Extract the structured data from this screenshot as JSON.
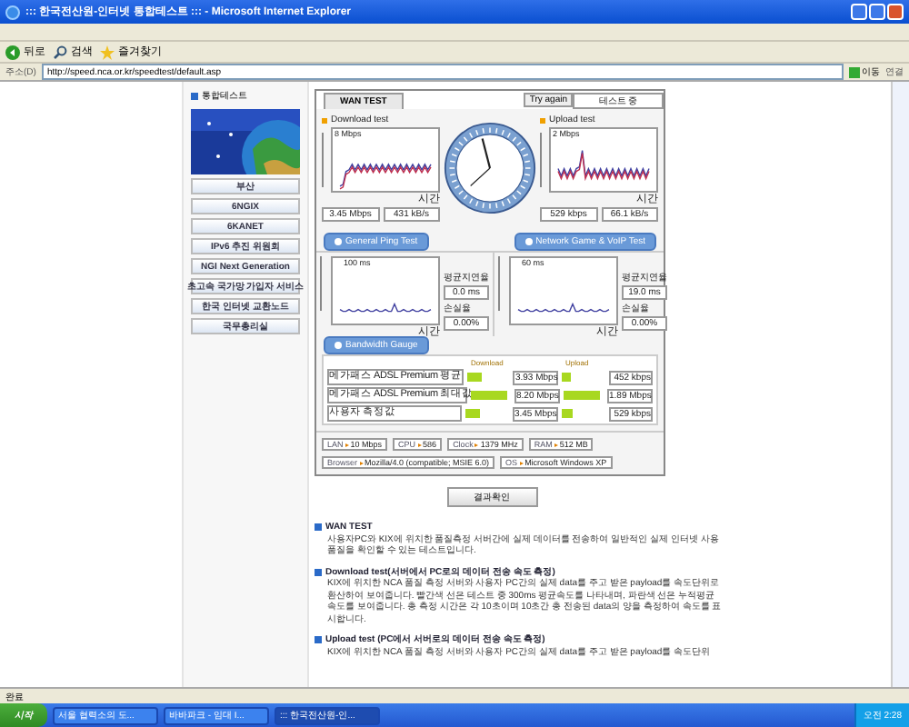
{
  "window": {
    "title": "::: 한국전산원-인터넷 통합테스트 ::: - Microsoft Internet Explorer"
  },
  "toolbar": {
    "buttons": [
      {
        "label": "뒤로"
      },
      {
        "label": "검색"
      },
      {
        "label": "즐겨찾기"
      }
    ]
  },
  "address_bar": {
    "label": "주소(D)",
    "url": "http://speed.nca.or.kr/speedtest/default.asp",
    "go": "이동",
    "links": "연결"
  },
  "sidebar": {
    "title": "통합테스트",
    "banners": [
      {
        "label": "부산"
      },
      {
        "label": "6NGIX"
      },
      {
        "label": "6KANET"
      },
      {
        "label": "IPv6 추진 위원회"
      },
      {
        "label": "NGI Next Generation"
      },
      {
        "label": "초고속 국가망 가입자 서비스"
      },
      {
        "label": "한국 인터넷 교환노드"
      },
      {
        "label": "국무총리실"
      }
    ]
  },
  "speed_test": {
    "tab": "WAN TEST",
    "retry": "Try again",
    "status": "테스트 중",
    "download": {
      "title": "Download test",
      "scale": "8 Mbps",
      "time": "시간",
      "rate": "3.45 Mbps",
      "bytes": "431 kB/s"
    },
    "upload": {
      "title": "Upload test",
      "scale": "2 Mbps",
      "time": "시간",
      "rate": "529 kbps",
      "bytes": "66.1 kB/s"
    },
    "ping_tests": [
      {
        "button": "General Ping Test",
        "scale": "100 ms",
        "time": "시간",
        "delay_label": "평균지연율",
        "delay": "0.0 ms",
        "loss_label": "손실율",
        "loss": "0.00%"
      },
      {
        "button": "Network Game & VoIP Test",
        "scale": "60 ms",
        "time": "시간",
        "delay_label": "평균지연율",
        "delay": "19.0 ms",
        "loss_label": "손실율",
        "loss": "0.00%"
      }
    ],
    "bandwidth": {
      "button": "Bandwidth Gauge",
      "download_label": "Download",
      "upload_label": "Upload",
      "rows": [
        {
          "name": "메가패스 ADSL Premium 평균",
          "download": {
            "level": 0.35,
            "reading": "3.93 Mbps"
          },
          "upload": {
            "level": 0.2,
            "reading": "452 kbps"
          }
        },
        {
          "name": "메가패스 ADSL Premium 최대값",
          "download": {
            "level": 0.9,
            "reading": "8.20 Mbps"
          },
          "upload": {
            "level": 0.9,
            "reading": "1.89 Mbps"
          }
        },
        {
          "name": "사용자 측정값",
          "download": {
            "level": 0.35,
            "reading": "3.45 Mbps"
          },
          "upload": {
            "level": 0.24,
            "reading": "529 kbps"
          }
        }
      ]
    },
    "system": [
      {
        "label": "LAN",
        "value": "10 Mbps"
      },
      {
        "label": "CPU",
        "value": "586"
      },
      {
        "label": "Clock",
        "value": "1379 MHz"
      },
      {
        "label": "RAM",
        "value": "512 MB"
      },
      {
        "label": "Browser",
        "value": "Mozilla/4.0 (compatible; MSIE 6.0)"
      },
      {
        "label": "OS",
        "value": "Microsoft Windows XP"
      }
    ],
    "result_button": "결과확인"
  },
  "sections": [
    {
      "title": "WAN TEST",
      "text": "사용자PC와 KIX에 위치한 품질측정 서버간에 실제 데이터를 전송하여 일반적인 실제 인터넷 사용 품질을 확인할 수 있는 테스트입니다."
    },
    {
      "title": "Download test(서버에서 PC로의 데이터 전송 속도 측정)",
      "text": "KIX에 위치한 NCA 품질 측정 서버와 사용자 PC간의 실제 data를 주고 받은 payload를 속도단위로 환산하여 보여줍니다. 빨간색 선은 테스트 중 300ms 평균속도를 나타내며, 파란색 선은 누적평균 속도를 보여줍니다. 총 측정 시간은 각 10초이며 10초간 총 전송된 data의 양을 측정하여 속도를 표시합니다."
    },
    {
      "title": "Upload test (PC에서 서버로의 데이터 전송 속도 측정)",
      "text": "KIX에 위치한 NCA 품질 측정 서버와 사용자 PC간의 실제 data를 주고 받은 payload를 속도단위"
    }
  ],
  "status_bar": {
    "text": "완료"
  },
  "taskbar": {
    "start": "시작",
    "tasks": [
      {
        "label": "서울 협력소의 도...",
        "selected": false
      },
      {
        "label": "바바파크 - 임대 I...",
        "selected": false
      },
      {
        "label": "::: 한국전산원-인...",
        "selected": true
      }
    ],
    "clock": "오전 2:28"
  }
}
